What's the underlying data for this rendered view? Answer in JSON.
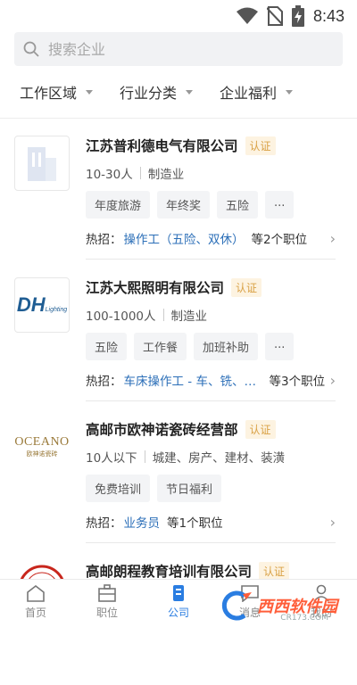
{
  "status_bar": {
    "time": "8:43",
    "icons": [
      "wifi-icon",
      "no-sim-icon",
      "battery-charging-icon"
    ]
  },
  "search": {
    "placeholder": "搜索企业"
  },
  "filters": [
    {
      "label": "工作区域"
    },
    {
      "label": "行业分类"
    },
    {
      "label": "企业福利"
    }
  ],
  "companies": [
    {
      "name": "江苏普利德电气有限公司",
      "badge": "认证",
      "size": "10-30人",
      "industry": "制造业",
      "tags": [
        "年度旅游",
        "年终奖",
        "五险",
        "..."
      ],
      "hot_label": "热招：",
      "hot_job": "操作工（五险、双休）",
      "hot_count": "等2个职位",
      "logo": "placeholder-building"
    },
    {
      "name": "江苏大熙照明有限公司",
      "badge": "认证",
      "size": "100-1000人",
      "industry": "制造业",
      "tags": [
        "五险",
        "工作餐",
        "加班补助",
        "..."
      ],
      "hot_label": "热招：",
      "hot_job": "车床操作工 - 车、铣、刨...",
      "hot_count": "等3个职位",
      "logo_text_main": "DH",
      "logo_text_sub": "Lighting"
    },
    {
      "name": "高邮市欧神诺瓷砖经营部",
      "badge": "认证",
      "size": "10人以下",
      "industry": "城建、房产、建材、装潢",
      "tags": [
        "免费培训",
        "节日福利"
      ],
      "hot_label": "热招：",
      "hot_job": "业务员",
      "hot_count": "等1个职位",
      "logo_text_main": "OCEANO",
      "logo_text_sub": "欧神诺瓷砖"
    },
    {
      "name": "高邮朗程教育培训有限公司",
      "badge": "认证"
    }
  ],
  "tabbar": [
    {
      "label": "首页",
      "icon": "home-icon"
    },
    {
      "label": "职位",
      "icon": "briefcase-icon"
    },
    {
      "label": "公司",
      "icon": "company-icon",
      "active": true
    },
    {
      "label": "消息",
      "icon": "message-icon"
    },
    {
      "label": "我的",
      "icon": "profile-icon"
    }
  ],
  "watermark": {
    "text": "西西软件园",
    "url": "CR173.COM"
  },
  "colors": {
    "accent": "#2a7de1",
    "link": "#2c6fb8",
    "badge_text": "#d9a145",
    "badge_bg": "#fdf3e1"
  }
}
